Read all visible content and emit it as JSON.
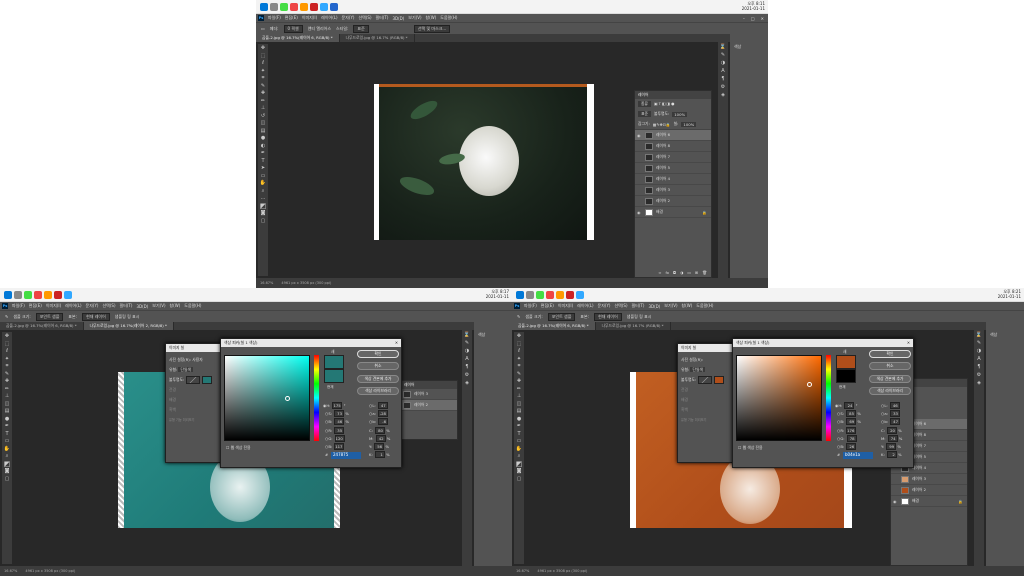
{
  "taskbar": {
    "time_top": "오후 8:11",
    "date_top": "2021-01-11",
    "time_bl": "오후 8:17",
    "date_bl": "2021-01-11",
    "time_br": "오후 8:21",
    "date_br": "2021-01-11",
    "lang": "A"
  },
  "menu": [
    "파일(F)",
    "편집(E)",
    "이미지(I)",
    "레이어(L)",
    "문자(Y)",
    "선택(S)",
    "필터(T)",
    "3D(D)",
    "보기(V)",
    "창(W)",
    "도움말(H)"
  ],
  "options": {
    "feather_label": "페더:",
    "feather_value": "0 픽셀",
    "antialias": "앤티 앨리어스",
    "style_label": "스타일:",
    "style_value": "표준",
    "select_mask": "선택 및 마스크...",
    "sample_label": "샘플 크기:",
    "sample_value": "포인트 샘플",
    "sample_from_label": "표본:",
    "sample_from_value": "현재 레이어",
    "show_ring": "샘플링 링 표시"
  },
  "tabs": {
    "tab1": "곰돌-2.jpg @ 16.7%(레이어 6, RGB/8) *",
    "tab2": "나무드로잉.jpg @ 16.7% (RGB/8) *",
    "tab3": "나무드로잉.jpg @ 16.7%(레이어 2, RGB/8) *"
  },
  "status": {
    "zoom": "16.67%",
    "doc": "4961 px x 3508 px (300 ppi)"
  },
  "layers_panel": {
    "title": "레이어",
    "kind": "종류",
    "blend": "표준",
    "opacity_label": "불투명도:",
    "opacity_value": "100%",
    "lock_label": "잠그기:",
    "fill_label": "칠:",
    "fill_value": "100%",
    "layers": [
      "레이어 6",
      "레이어 8",
      "레이어 7",
      "레이어 5",
      "레이어 4",
      "레이어 3",
      "레이어 2",
      "배경"
    ]
  },
  "right_dock": {
    "color_label": "색상"
  },
  "fill_dialog": {
    "title": "이미지 칠",
    "section": "사전 설정(R):",
    "preset": "사용자",
    "type_label": "유형:",
    "type_value": "단일색",
    "opacity_label": "불투명도:",
    "row_a": "전경",
    "row_b": "배경",
    "row_c": "흑백",
    "row_d": "기타",
    "note": "유형 기능 미리보기"
  },
  "color_picker": {
    "title": "색상 피커(칠 1 색상)",
    "ok": "확인",
    "cancel": "취소",
    "add_swatch": "색상 견본에 추가",
    "libraries": "색상 라이브러리",
    "new_label": "새",
    "current_label": "현재",
    "web_only": "웹 색상 전용",
    "left": {
      "H": "175",
      "S": "73",
      "B": "46",
      "R": "35",
      "G": "120",
      "Bv": "117",
      "L": "47",
      "a": "-28",
      "b": "-6",
      "C": "80",
      "M": "42",
      "Y": "56",
      "K": "1",
      "hex": "247875",
      "color": "#247875"
    },
    "right": {
      "H": "24",
      "S": "85",
      "B": "69",
      "R": "176",
      "G": "78",
      "Bv": "26",
      "L": "46",
      "a": "33",
      "b": "47",
      "C": "20",
      "M": "74",
      "Y": "99",
      "K": "2",
      "hex": "b04e1a",
      "color": "#b04e1a"
    }
  }
}
